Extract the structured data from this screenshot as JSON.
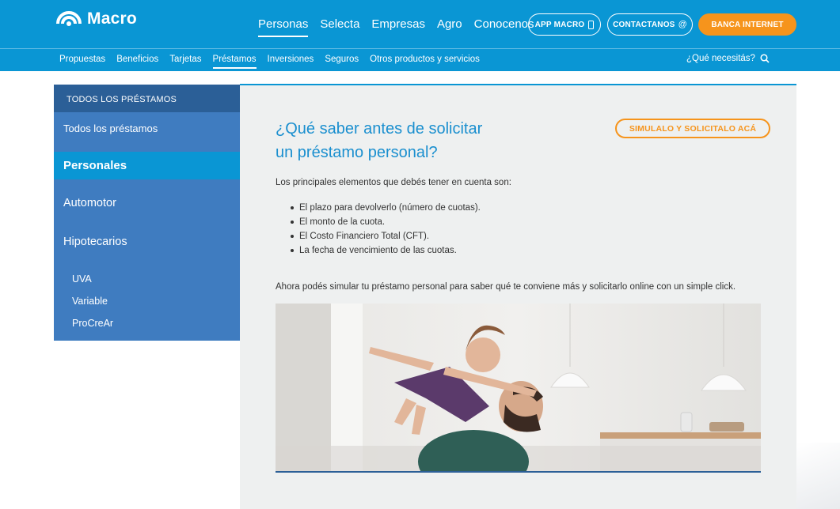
{
  "brand": {
    "name": "Macro"
  },
  "main_nav": [
    "Personas",
    "Selecta",
    "Empresas",
    "Agro",
    "Conocenos"
  ],
  "main_nav_active": "Personas",
  "header_buttons": {
    "app": "APP MACRO",
    "contact": "CONTACTANOS",
    "contact_icon": "@",
    "banca": "BANCA INTERNET"
  },
  "sub_nav": [
    "Propuestas",
    "Beneficios",
    "Tarjetas",
    "Préstamos",
    "Inversiones",
    "Seguros",
    "Otros productos y servicios"
  ],
  "sub_nav_active": "Préstamos",
  "search": {
    "label": "¿Qué necesitás?"
  },
  "sidebar": {
    "heading": "TODOS LOS PRÉSTAMOS",
    "all": "Todos los préstamos",
    "personales": "Personales",
    "automotor": "Automotor",
    "hipotecarios": "Hipotecarios",
    "sub": [
      "UVA",
      "Variable",
      "ProCreAr"
    ]
  },
  "content": {
    "title_line1": "¿Qué saber antes de solicitar",
    "title_line2": "un préstamo personal?",
    "cta": "SIMULALO Y SOLICITALO ACÁ",
    "intro": "Los principales elementos que debés tener en cuenta son:",
    "bullets": [
      "El plazo para devolverlo (número de cuotas).",
      "El monto de la cuota.",
      "El Costo Financiero Total (CFT).",
      "La fecha de vencimiento de las cuotas."
    ],
    "outro": "Ahora podés simular tu préstamo personal para saber qué te conviene más y solicitarlo online con un simple click."
  },
  "colors": {
    "primary": "#0a96d4",
    "sidebar": "#3f7cc0",
    "sidebar_head": "#2b5f97",
    "accent": "#f6941c",
    "title": "#1a8fcf"
  }
}
